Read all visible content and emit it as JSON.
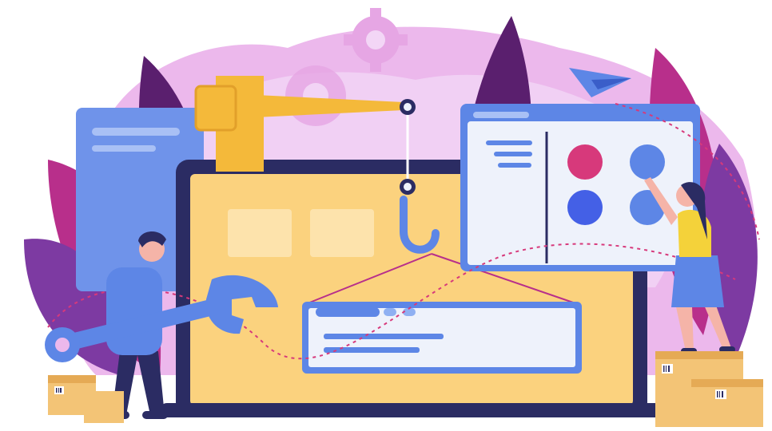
{
  "illustration": {
    "subject": "web-development-construction",
    "icons": [
      "gear-icon",
      "gear-icon",
      "paper-plane-icon",
      "crane-hook-icon",
      "wrench-icon",
      "barcode-icon"
    ],
    "colors": {
      "blob_pink": "#ecb8ec",
      "blob_lilac": "#f3d6f6",
      "leaf_magenta": "#b82f8b",
      "leaf_dark": "#5a1f6e",
      "leaf_purple": "#7d3aa2",
      "laptop_dark": "#2b2c63",
      "laptop_screen": "#fbd27e",
      "crane_yellow": "#f4b93a",
      "panel_blue": "#5d86e6",
      "panel_white": "#eef2fb",
      "dot_pink": "#d7397b",
      "dot_blue": "#4460e6",
      "box_tan": "#f3c476"
    }
  }
}
